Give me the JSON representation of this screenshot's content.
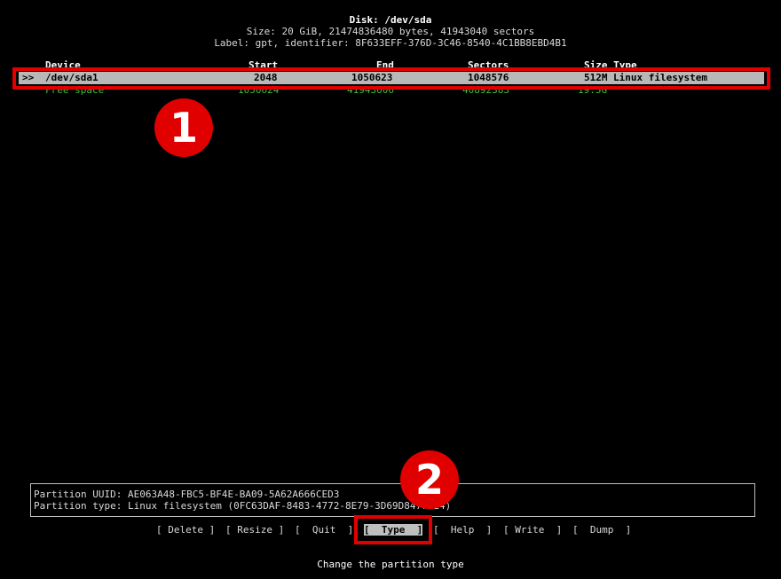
{
  "header": {
    "disk": "Disk: /dev/sda",
    "size": "Size: 20 GiB, 21474836480 bytes, 41943040 sectors",
    "label": "Label: gpt, identifier: 8F633EFF-376D-3C46-8540-4C1BB8EBD4B1"
  },
  "columns": {
    "device": "Device",
    "start": "Start",
    "end": "End",
    "sectors": "Sectors",
    "size_type": "Size Type"
  },
  "partitions": [
    {
      "marker": ">>",
      "device": "/dev/sda1",
      "start": "2048",
      "end": "1050623",
      "sectors": "1048576",
      "size": "512M",
      "type": "Linux filesystem"
    }
  ],
  "free_space": {
    "device": "Free space",
    "start": "1050624",
    "end": "41943006",
    "sectors": "40892383",
    "size": "19.5G"
  },
  "info": {
    "uuid": "Partition UUID: AE063A48-FBC5-BF4E-BA09-5A62A666CED3",
    "type": "Partition type: Linux filesystem (0FC63DAF-8483-4772-8E79-3D69D8477DE4)"
  },
  "menu": [
    {
      "label": "[ Delete ]"
    },
    {
      "label": "[ Resize ]"
    },
    {
      "label": "[  Quit  ]"
    },
    {
      "label": "[  Type  ]"
    },
    {
      "label": "[  Help  ]"
    },
    {
      "label": "[ Write  ]"
    },
    {
      "label": "[  Dump  ]"
    }
  ],
  "hint": "Change the partition type",
  "annotations": {
    "badge_1": "1",
    "badge_2": "2"
  },
  "colors": {
    "highlight": "#e00000",
    "free_space_text": "#3fbf3f",
    "selected_row_bg": "#b8b8b8"
  }
}
